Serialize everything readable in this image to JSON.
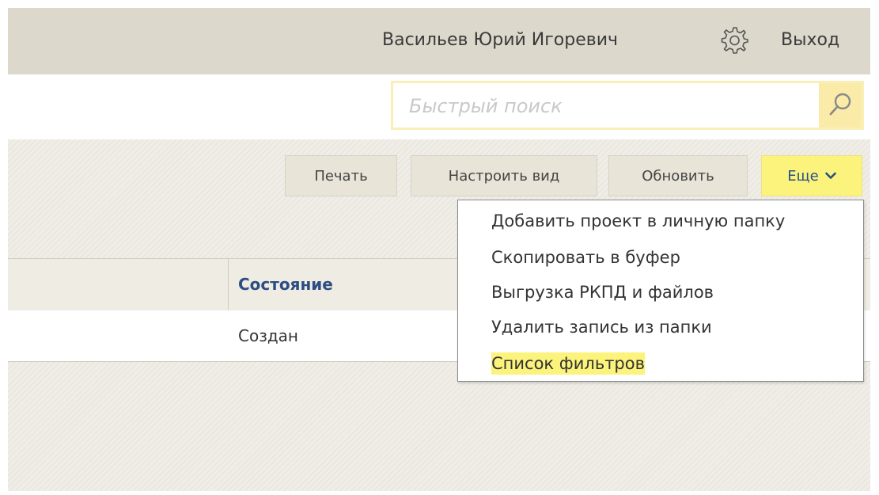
{
  "header": {
    "user_name": "Васильев Юрий Игоревич",
    "settings_icon": "gear-icon",
    "logout_label": "Выход"
  },
  "search": {
    "placeholder": "Быстрый поиск",
    "value": "",
    "button_icon": "search-icon"
  },
  "toolbar": {
    "print_label": "Печать",
    "customize_label": "Настроить вид",
    "refresh_label": "Обновить",
    "more_label": "Еще",
    "more_icon": "chevron-down-icon"
  },
  "table": {
    "columns": [
      "",
      "Состояние"
    ],
    "rows": [
      [
        "",
        "Создан"
      ]
    ]
  },
  "more_menu": {
    "items": [
      "Добавить проект в личную папку",
      "Скопировать в буфер",
      "Выгрузка РКПД и файлов",
      "Удалить запись из папки",
      "Список фильтров"
    ],
    "highlighted_index": 4
  },
  "colors": {
    "header_bg": "#dcd8cc",
    "highlight": "#fbf37b",
    "search_border": "#fbefb8",
    "column_header_text": "#2d4e82"
  }
}
